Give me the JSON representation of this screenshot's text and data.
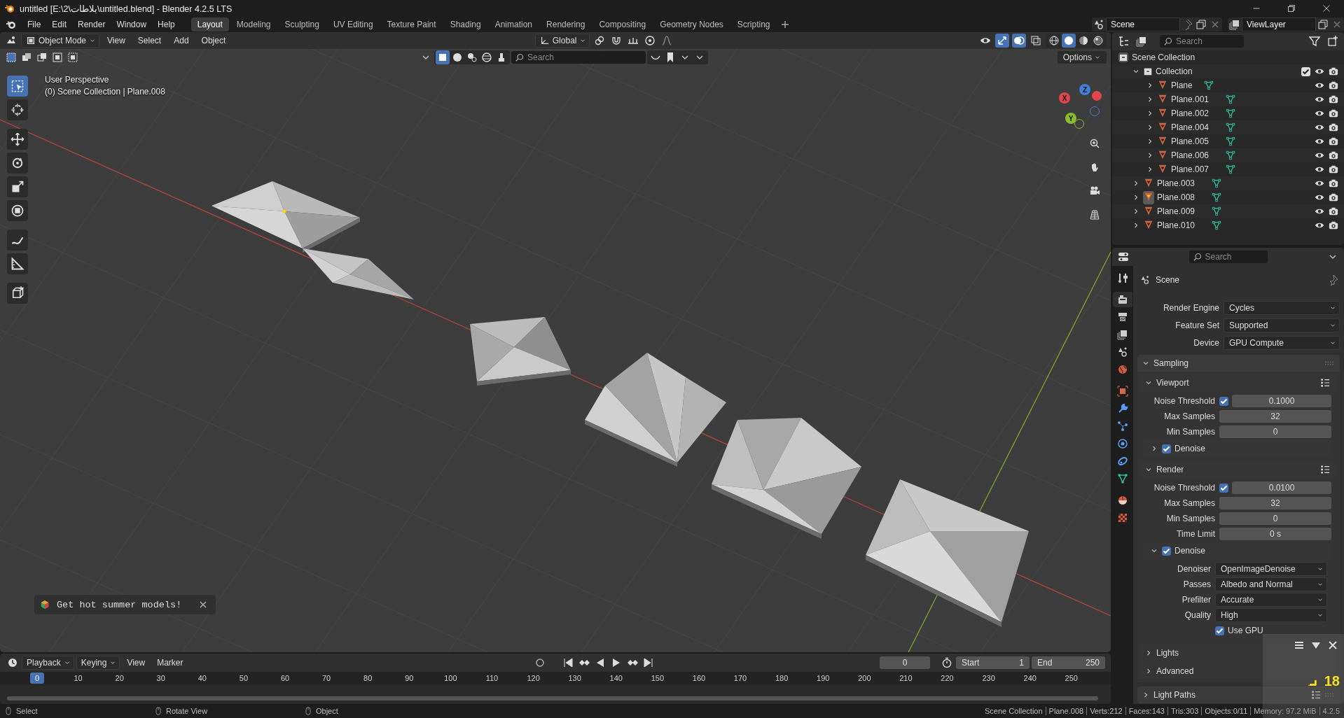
{
  "window": {
    "title": "untitled [E:\\2\\بلاطات\\untitled.blend] - Blender 4.2.5 LTS"
  },
  "menu": [
    "File",
    "Edit",
    "Render",
    "Window",
    "Help"
  ],
  "workspaces": [
    {
      "label": "Layout",
      "selected": true
    },
    {
      "label": "Modeling",
      "selected": false
    },
    {
      "label": "Sculpting",
      "selected": false
    },
    {
      "label": "UV Editing",
      "selected": false
    },
    {
      "label": "Texture Paint",
      "selected": false
    },
    {
      "label": "Shading",
      "selected": false
    },
    {
      "label": "Animation",
      "selected": false
    },
    {
      "label": "Rendering",
      "selected": false
    },
    {
      "label": "Compositing",
      "selected": false
    },
    {
      "label": "Geometry Nodes",
      "selected": false
    },
    {
      "label": "Scripting",
      "selected": false
    }
  ],
  "scene_selector": {
    "value": "Scene"
  },
  "view_layer_selector": {
    "value": "ViewLayer"
  },
  "viewport": {
    "mode": "Object Mode",
    "menus": [
      "View",
      "Select",
      "Add",
      "Object"
    ],
    "orientation": "Global",
    "search_placeholder": "Search",
    "options_label": "Options",
    "view_name": "User Perspective",
    "context": "(0) Scene Collection | Plane.008",
    "tools": [
      {
        "kind": "select",
        "selected": true
      },
      {
        "kind": "cursor",
        "selected": false
      },
      {
        "kind": "move",
        "selected": false
      },
      {
        "kind": "rotate",
        "selected": false
      },
      {
        "kind": "scale",
        "selected": false
      },
      {
        "kind": "transform",
        "selected": false
      },
      {
        "kind": "annotate",
        "selected": false
      },
      {
        "kind": "measure",
        "selected": false
      },
      {
        "kind": "add_cube",
        "selected": false
      }
    ],
    "axes": [
      {
        "label": "X",
        "color": "#e2454d"
      },
      {
        "label": "Y",
        "color": "#8bba2c"
      },
      {
        "label": "Z",
        "color": "#3f7fd8"
      }
    ],
    "shading": [
      {
        "kind": "wireframe",
        "selected": false
      },
      {
        "kind": "solid",
        "selected": true
      },
      {
        "kind": "material",
        "selected": false
      },
      {
        "kind": "rendered",
        "selected": false
      }
    ],
    "notification": "Get hot summer models!"
  },
  "outliner": {
    "search_placeholder": "Search",
    "tree": [
      {
        "label": "Scene Collection",
        "kind": "scene_collection",
        "children": [
          {
            "label": "Collection",
            "kind": "collection",
            "expanded": true,
            "checked": true,
            "children": [
              {
                "label": "Plane",
                "kind": "mesh",
                "expanded": false,
                "selected": false
              },
              {
                "label": "Plane.001",
                "kind": "mesh",
                "expanded": false,
                "selected": false
              },
              {
                "label": "Plane.002",
                "kind": "mesh",
                "expanded": false,
                "selected": false
              },
              {
                "label": "Plane.004",
                "kind": "mesh",
                "expanded": false,
                "selected": false
              },
              {
                "label": "Plane.005",
                "kind": "mesh",
                "expanded": false,
                "selected": false
              },
              {
                "label": "Plane.006",
                "kind": "mesh",
                "expanded": false,
                "selected": false
              },
              {
                "label": "Plane.007",
                "kind": "mesh",
                "expanded": false,
                "selected": false
              }
            ]
          },
          {
            "label": "Plane.003",
            "kind": "mesh",
            "expanded": false,
            "selected": false
          },
          {
            "label": "Plane.008",
            "kind": "mesh",
            "expanded": false,
            "selected": true
          },
          {
            "label": "Plane.009",
            "kind": "mesh",
            "expanded": false,
            "selected": false
          },
          {
            "label": "Plane.010",
            "kind": "mesh",
            "expanded": false,
            "selected": false
          }
        ]
      }
    ]
  },
  "properties": {
    "search_placeholder": "Search",
    "context": "Scene",
    "tabs": [
      {
        "kind": "tool",
        "selected": false
      },
      {
        "kind": "render",
        "selected": true
      },
      {
        "kind": "output",
        "selected": false
      },
      {
        "kind": "view_layer",
        "selected": false
      },
      {
        "kind": "scene",
        "selected": false
      },
      {
        "kind": "world",
        "selected": false
      },
      {
        "kind": "object",
        "selected": false
      },
      {
        "kind": "modifiers",
        "selected": false
      },
      {
        "kind": "particles",
        "selected": false
      },
      {
        "kind": "physics",
        "selected": false
      },
      {
        "kind": "constraints",
        "selected": false
      },
      {
        "kind": "data",
        "selected": false
      },
      {
        "kind": "material",
        "selected": false
      },
      {
        "kind": "texture",
        "selected": false
      }
    ],
    "fields": [
      {
        "kind": "dropdown",
        "label": "Render Engine",
        "value": "Cycles"
      },
      {
        "kind": "dropdown",
        "label": "Feature Set",
        "value": "Supported"
      },
      {
        "kind": "dropdown",
        "label": "Device",
        "value": "GPU Compute"
      }
    ],
    "panels": [
      {
        "kind": "subpanel",
        "title": "Sampling",
        "expanded": true,
        "presets_menu": false,
        "items": [
          {
            "kind": "subpanel",
            "title": "Viewport",
            "expanded": true,
            "presets_menu": true,
            "items": [
              {
                "kind": "check_number",
                "label": "Noise Threshold",
                "checked": true,
                "value": "0.1000"
              },
              {
                "kind": "number",
                "label": "Max Samples",
                "value": "32"
              },
              {
                "kind": "number",
                "label": "Min Samples",
                "value": "0"
              },
              {
                "kind": "subpanel",
                "title": "Denoise",
                "checked": true,
                "expanded": false,
                "presets_menu": false
              }
            ]
          },
          {
            "kind": "subpanel",
            "title": "Render",
            "expanded": true,
            "presets_menu": true,
            "items": [
              {
                "kind": "check_number",
                "label": "Noise Threshold",
                "checked": true,
                "value": "0.0100"
              },
              {
                "kind": "number",
                "label": "Max Samples",
                "value": "32"
              },
              {
                "kind": "number",
                "label": "Min Samples",
                "value": "0"
              },
              {
                "kind": "number",
                "label": "Time Limit",
                "value": "0 s"
              },
              {
                "kind": "subpanel",
                "title": "Denoise",
                "checked": true,
                "expanded": true,
                "presets_menu": false,
                "items": [
                  {
                    "kind": "dropdown",
                    "label": "Denoiser",
                    "value": "OpenImageDenoise"
                  },
                  {
                    "kind": "dropdown",
                    "label": "Passes",
                    "value": "Albedo and Normal"
                  },
                  {
                    "kind": "dropdown",
                    "label": "Prefilter",
                    "value": "Accurate"
                  },
                  {
                    "kind": "dropdown",
                    "label": "Quality",
                    "value": "High"
                  },
                  {
                    "kind": "checkbox",
                    "label": "Use GPU",
                    "checked": true
                  }
                ]
              }
            ]
          },
          {
            "kind": "subpanel",
            "title": "Lights",
            "expanded": false,
            "presets_menu": false
          },
          {
            "kind": "subpanel",
            "title": "Advanced",
            "expanded": false,
            "presets_menu": false
          }
        ]
      },
      {
        "kind": "subpanel",
        "title": "Light Paths",
        "expanded": false,
        "presets_menu": true
      }
    ]
  },
  "timeline": {
    "menus": [
      "Playback",
      "Keying",
      "View",
      "Marker"
    ],
    "current_frame": "0",
    "start_label": "Start",
    "start": "1",
    "end_label": "End",
    "end": "250",
    "playhead": "0",
    "ruler": [
      "10",
      "20",
      "30",
      "40",
      "50",
      "60",
      "70",
      "80",
      "90",
      "100",
      "110",
      "120",
      "130",
      "140",
      "150",
      "160",
      "170",
      "180",
      "190",
      "200",
      "210",
      "220",
      "230",
      "240",
      "250"
    ]
  },
  "status_bar": {
    "hints": [
      "Select",
      "Rotate View",
      "Object"
    ],
    "stats": [
      "Scene Collection",
      "Plane.008",
      "Verts:212",
      "Faces:143",
      "Tris:303",
      "Objects:0/11",
      "Memory: 97.2 MiB",
      "4.2.5"
    ]
  },
  "fps_overlay": {
    "value": "18"
  }
}
